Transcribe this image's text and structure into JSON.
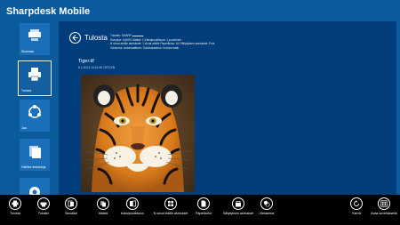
{
  "app": {
    "title": "Sharpdesk Mobile"
  },
  "sidebar": {
    "items": [
      {
        "label": "Skannaa",
        "icon": "scanner-icon"
      },
      {
        "label": "Tulosta",
        "icon": "printer-icon"
      },
      {
        "label": "Jaa",
        "icon": "share-icon"
      },
      {
        "label": "Hallitse tiedostoja",
        "icon": "file-manager-icon"
      },
      {
        "label": "",
        "icon": "gear-icon"
      }
    ]
  },
  "header": {
    "title": "Tulosta"
  },
  "settings": {
    "lines": [
      "Tulostin: SHARP ▬▬▬▬",
      "Sivualue: KAIKKI   Määrä: 1   Kaksipuoleisuus: 1-puoleinen",
      "N sivua arkille asetukset: 1 sivua arkille   Paperikoko: A4   Säilytyksen asetukset: Pois",
      "Värisetus: Automaattinen   Tulostusasetus: Korkea laatu"
    ]
  },
  "file": {
    "name": "Tiger.tif",
    "meta": "6.1.2014 14:11:46  2370 KB"
  },
  "appbar": {
    "left": [
      {
        "label": "Tulosta",
        "icon": "printer-icon"
      },
      {
        "label": "Tulostin",
        "icon": "printer-select-icon"
      },
      {
        "label": "Sivualue",
        "icon": "page-range-icon"
      },
      {
        "label": "Määrä",
        "icon": "copies-icon"
      },
      {
        "label": "Kaksipuoleisuus",
        "icon": "duplex-icon"
      },
      {
        "label": "N sivua arkille asetukset",
        "icon": "n-up-icon"
      },
      {
        "label": "Paperikoko",
        "icon": "paper-size-icon"
      },
      {
        "label": "Säilytyksen asetukset",
        "icon": "retention-icon"
      },
      {
        "label": "Väriasetus",
        "icon": "color-icon"
      }
    ],
    "right": [
      {
        "label": "Kierrä",
        "icon": "rotate-icon"
      },
      {
        "label": "Avaa sovelluksella",
        "icon": "open-with-icon"
      }
    ]
  }
}
